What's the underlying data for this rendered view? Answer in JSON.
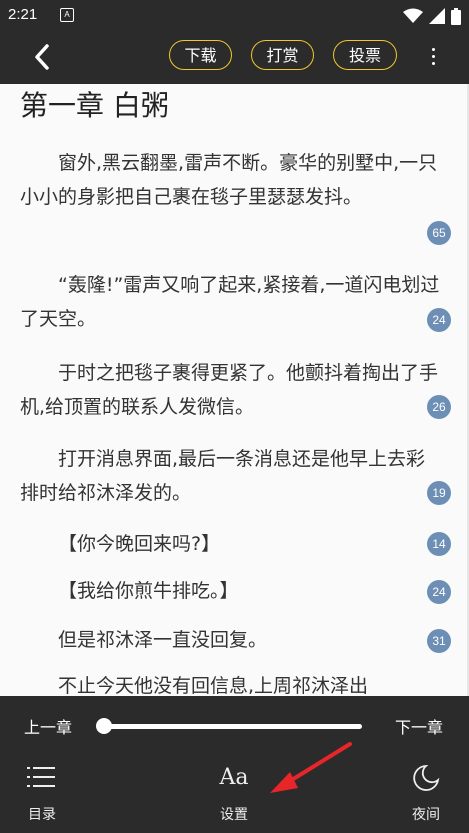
{
  "status_bar": {
    "time": "2:21",
    "notification_icon": "A"
  },
  "toolbar": {
    "back_icon": "chevron-left",
    "download_label": "下载",
    "tip_label": "打赏",
    "vote_label": "投票",
    "more_icon": "three-dots-vertical",
    "accent_color": "#f2c62c"
  },
  "chapter": {
    "title": "第一章 白粥",
    "paragraphs": [
      {
        "text": "窗外,黑云翻墨,雷声不断。豪华的别墅中,一只小小的身影把自己裹在毯子里瑟瑟发抖。",
        "comment_count": "65"
      },
      {
        "text": "“轰隆!”雷声又响了起来,紧接着,一道闪电划过了天空。",
        "comment_count": "24"
      },
      {
        "text": "于时之把毯子裹得更紧了。他颤抖着掏出了手机,给顶置的联系人发微信。",
        "comment_count": "26"
      },
      {
        "text": "打开消息界面,最后一条消息还是他早上去彩排时给祁沐泽发的。",
        "comment_count": "19"
      },
      {
        "text": "【你今晚回来吗?】",
        "comment_count": "14"
      },
      {
        "text": "【我给你煎牛排吃。】",
        "comment_count": "24"
      },
      {
        "text": "但是祁沐泽一直没回复。",
        "comment_count": "31"
      },
      {
        "text": "不止今天他没有回信息,上周祁沐泽出",
        "comment_count": ""
      }
    ],
    "badge_color": "#6d8fb5"
  },
  "bottom_panel": {
    "prev_chapter": "上一章",
    "next_chapter": "下一章",
    "progress": 0,
    "tools": [
      {
        "label": "目录",
        "icon": "list-icon"
      },
      {
        "label": "设置",
        "icon": "font-aa-icon",
        "glyph": "Aa"
      },
      {
        "label": "夜间",
        "icon": "moon-icon"
      }
    ]
  },
  "annotation": {
    "arrow_color": "#e8262a"
  }
}
